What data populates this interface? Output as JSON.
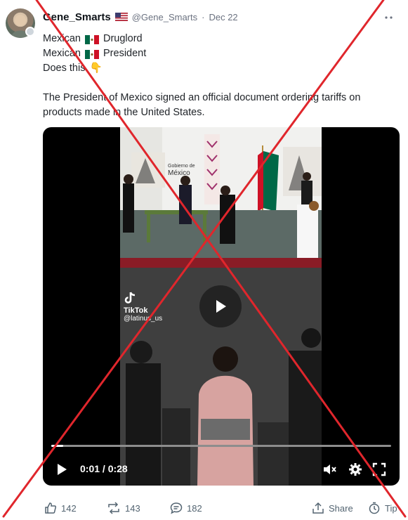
{
  "author": {
    "display_name": "Gene_Smarts",
    "handle": "@Gene_Smarts",
    "separator": "·",
    "date": "Dec 22"
  },
  "post": {
    "line1_start": "Mexican",
    "line1_end": "Druglord",
    "line2_start": "Mexican",
    "line2_end": "President",
    "line3": "Does this",
    "line3_emoji": "👇",
    "paragraph": "The President of Mexico signed an official document ordering tariffs on products made in the United States."
  },
  "video": {
    "tiktok_label": "TikTok",
    "tiktok_handle": "@latinus_us",
    "sign_line1": "Gobierno de",
    "sign_line2": "México",
    "time": "0:01 / 0:28",
    "progress": 0.036
  },
  "actions": {
    "likes": "142",
    "reposts": "143",
    "comments": "182",
    "share": "Share",
    "tip": "Tip"
  },
  "colors": {
    "cross": "#e0262c",
    "brand_mx_green": "#006847",
    "brand_mx_red": "#ce1126"
  }
}
